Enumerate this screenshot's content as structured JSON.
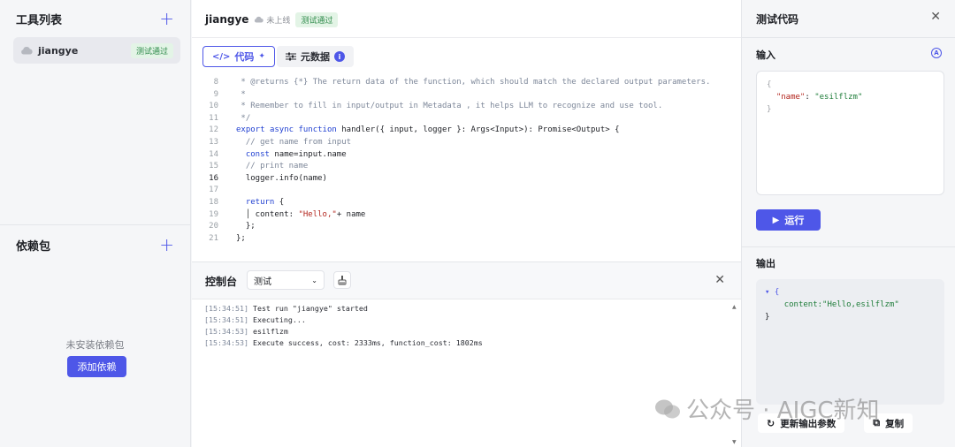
{
  "left": {
    "title": "工具列表",
    "tool": {
      "name": "jiangye",
      "badge": "测试通过"
    },
    "deps_title": "依赖包",
    "empty_text": "未安装依赖包",
    "add_dep_label": "添加依赖"
  },
  "middle": {
    "title": "jiangye",
    "status": "未上线",
    "badge": "测试通过",
    "tabs": [
      {
        "label": "代码"
      },
      {
        "label": "元数据"
      }
    ],
    "code_lines": [
      {
        "n": "8",
        "text": " * @returns {*} The return data of the function, which should match the declared output parameters."
      },
      {
        "n": "9",
        "text": " *"
      },
      {
        "n": "10",
        "text": " * Remember to fill in input/output in Metadata , it helps LLM to recognize and use tool."
      },
      {
        "n": "11",
        "text": " */"
      },
      {
        "n": "12",
        "text": "export async function handler({ input, logger }: Args<Input>): Promise<Output> {"
      },
      {
        "n": "13",
        "text": "  // get name from input"
      },
      {
        "n": "14",
        "text": "  const name=input.name"
      },
      {
        "n": "15",
        "text": "  // print name"
      },
      {
        "n": "16",
        "text": "  logger.info(name)"
      },
      {
        "n": "17",
        "text": ""
      },
      {
        "n": "18",
        "text": "  return {"
      },
      {
        "n": "19",
        "text": "  │ content: \"Hello,\"+ name"
      },
      {
        "n": "20",
        "text": "  };"
      },
      {
        "n": "21",
        "text": "};"
      }
    ],
    "console": {
      "title": "控制台",
      "select_value": "测试",
      "logs": [
        {
          "ts": "[15:34:51]",
          "msg": " Test run \"jiangye\" started"
        },
        {
          "ts": "[15:34:51]",
          "msg": " Executing..."
        },
        {
          "ts": "[15:34:53]",
          "msg": " esilflzm"
        },
        {
          "ts": "[15:34:53]",
          "msg": " Execute success, cost: 2333ms, function_cost: 1802ms"
        }
      ]
    }
  },
  "right": {
    "title": "测试代码",
    "input_label": "输入",
    "input_json": {
      "open": "{",
      "key": "\"name\"",
      "colon": ": ",
      "value": "\"esilflzm\"",
      "close": "}"
    },
    "run_label": "运行",
    "output_label": "输出",
    "output_json": {
      "open": "▾ {",
      "key": "content",
      "colon": ":",
      "value": "\"Hello,esilflzm\"",
      "close": "}"
    },
    "update_label": "更新输出参数",
    "copy_label": "复制"
  },
  "watermark": "公众号 · AIGC新知",
  "colors": {
    "accent": "#4e57e8",
    "success_bg": "#e3f4e6",
    "success_text": "#2e8a4a"
  }
}
